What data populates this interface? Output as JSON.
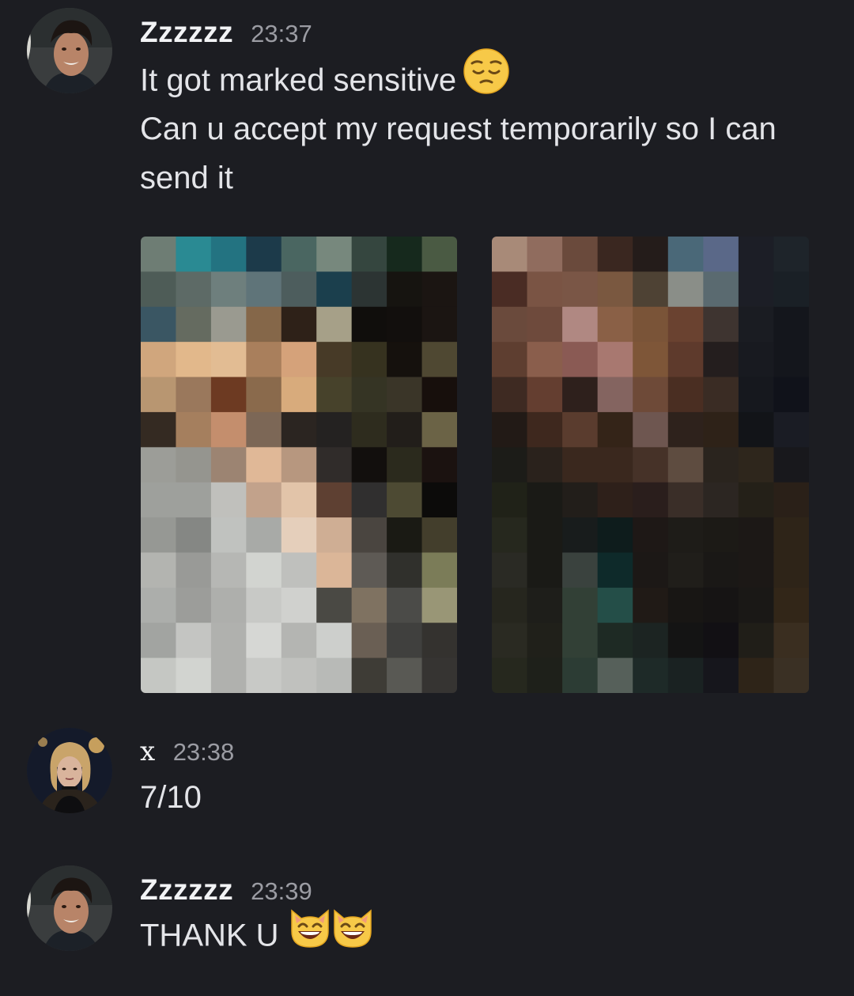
{
  "messages": [
    {
      "author": "Zzzzzz",
      "time": "23:37",
      "lines": [
        "It got marked sensitive",
        "Can u accept my request temporarily so I can",
        "send it"
      ],
      "line_emoji": "pensive-face",
      "attachments": [
        {
          "description": "pixelated-image",
          "cols": 9,
          "rows": 13,
          "pixels": [
            [
              "#6e7d74",
              "#2a8a93",
              "#237381",
              "#1c3a4a",
              "#4a6661",
              "#77887d",
              "#35463f",
              "#16291d",
              "#4a5a43"
            ],
            [
              "#4e5c57",
              "#5d6a66",
              "#6e7f7d",
              "#5f7479",
              "#4d5d5d",
              "#1b3f4d",
              "#2c3433",
              "#161410",
              "#1b1512"
            ],
            [
              "#3a5663",
              "#656b60",
              "#9a9a90",
              "#856749",
              "#2e2118",
              "#a6a088",
              "#100e0c",
              "#120f0d",
              "#1b1512"
            ],
            [
              "#d0a67d",
              "#e2b88b",
              "#e2bc93",
              "#a97f5c",
              "#d5a27a",
              "#473a27",
              "#36321f",
              "#15110d",
              "#4f4832"
            ],
            [
              "#b89671",
              "#9a785c",
              "#6d3a22",
              "#8a6a4c",
              "#d8ab7c",
              "#47422b",
              "#353424",
              "#3a3528",
              "#170f0c"
            ],
            [
              "#342a22",
              "#a57f5e",
              "#c48e6d",
              "#7c6756",
              "#2b2521",
              "#242221",
              "#2e2c1e",
              "#221e1a",
              "#6b6346"
            ],
            [
              "#9c9d98",
              "#95958f",
              "#9c8472",
              "#e0b897",
              "#b7977f",
              "#302c2a",
              "#120f0d",
              "#2b2a1d",
              "#1b1210"
            ],
            [
              "#9ea09c",
              "#9ea09c",
              "#c0c0bc",
              "#c2a28b",
              "#e2c4a9",
              "#5e4032",
              "#302f2f",
              "#4d4a33",
              "#0c0b0a"
            ],
            [
              "#969894",
              "#858784",
              "#c0c2bf",
              "#a8aaa7",
              "#e5cfbb",
              "#cfae94",
              "#4a4540",
              "#1a1a14",
              "#433e2c"
            ],
            [
              "#b3b4b0",
              "#999a97",
              "#b6b7b4",
              "#d2d4d0",
              "#bfc0bd",
              "#dbb698",
              "#5e5a55",
              "#30302c",
              "#7b7c58"
            ],
            [
              "#acaeab",
              "#9c9d9a",
              "#aeafac",
              "#c8c9c6",
              "#d0d1ce",
              "#4a4944",
              "#7f7261",
              "#4b4b48",
              "#999676"
            ],
            [
              "#a2a4a1",
              "#c4c5c2",
              "#b0b1ae",
              "#d6d7d4",
              "#b4b5b2",
              "#cdcfcc",
              "#6a5f54",
              "#40403e",
              "#34322f"
            ],
            [
              "#c5c7c3",
              "#d2d4d0",
              "#b0b1ae",
              "#c8c9c6",
              "#c0c1be",
              "#b8bab7",
              "#3e3c36",
              "#595954",
              "#363432"
            ]
          ]
        },
        {
          "description": "pixelated-image",
          "cols": 9,
          "rows": 13,
          "pixels": [
            [
              "#a88a78",
              "#906c5e",
              "#6a4a3c",
              "#3a2720",
              "#241c1a",
              "#4a6878",
              "#5a6888",
              "#1c1e26",
              "#1e242a"
            ],
            [
              "#4a2c24",
              "#7a5444",
              "#7a5646",
              "#7a5840",
              "#4e4234",
              "#8a8e88",
              "#5a6a70",
              "#1c1e26",
              "#1a2026"
            ],
            [
              "#6a4a3c",
              "#6e4a3c",
              "#b08882",
              "#8a6046",
              "#7a5438",
              "#6a4230",
              "#3e3430",
              "#1a1c22",
              "#14161c"
            ],
            [
              "#5e3e30",
              "#8a5e4c",
              "#8a5a54",
              "#a87870",
              "#7e5638",
              "#5e3a2c",
              "#241e1e",
              "#181a20",
              "#14161c"
            ],
            [
              "#3e2a22",
              "#643e30",
              "#2e201c",
              "#846460",
              "#6e4a38",
              "#4a2e22",
              "#3a2c24",
              "#16181e",
              "#10121a"
            ],
            [
              "#221a16",
              "#3e281e",
              "#5a3c2e",
              "#342418",
              "#6e5650",
              "#2e221c",
              "#2e2218",
              "#121418",
              "#1a1c24"
            ],
            [
              "#1c1c18",
              "#2a221c",
              "#3a281e",
              "#3a281e",
              "#463228",
              "#5e4c40",
              "#2a241e",
              "#2e261c",
              "#18181c"
            ],
            [
              "#202218",
              "#1a1a16",
              "#221e1a",
              "#2e201a",
              "#2a1e1c",
              "#3a2e28",
              "#2c2622",
              "#242018",
              "#2a2018"
            ],
            [
              "#26281e",
              "#1a1a16",
              "#181c1c",
              "#0e1c1c",
              "#1e1816",
              "#1e1c18",
              "#1c1a16",
              "#1c1816",
              "#2e2418"
            ],
            [
              "#2a2a24",
              "#1a1a16",
              "#3a423e",
              "#0e2a2a",
              "#1c1816",
              "#201e1a",
              "#1a1816",
              "#1c1816",
              "#2e2418"
            ],
            [
              "#26261e",
              "#1e1e1a",
              "#324036",
              "#244e48",
              "#201a16",
              "#181614",
              "#161414",
              "#1a1816",
              "#322618"
            ],
            [
              "#2a2a22",
              "#20201a",
              "#324036",
              "#1e2a24",
              "#1c2422",
              "#141414",
              "#121014",
              "#201e18",
              "#3a2e20"
            ],
            [
              "#26281e",
              "#1e201a",
              "#2c3c34",
              "#56605a",
              "#1e2a28",
              "#1a2222",
              "#16161c",
              "#2e2418",
              "#3a3024"
            ]
          ]
        }
      ]
    },
    {
      "author": "x",
      "time": "23:38",
      "lines": [
        "7/10"
      ]
    },
    {
      "author": "Zzzzzz",
      "time": "23:39",
      "lines": [
        "THANK U"
      ],
      "line_emoji": "grinning-cat-face"
    }
  ],
  "colors": {
    "background": "#1c1d22",
    "username": "#f2f3f5",
    "timestamp": "#9b9ca3",
    "text": "#e3e4e8"
  }
}
